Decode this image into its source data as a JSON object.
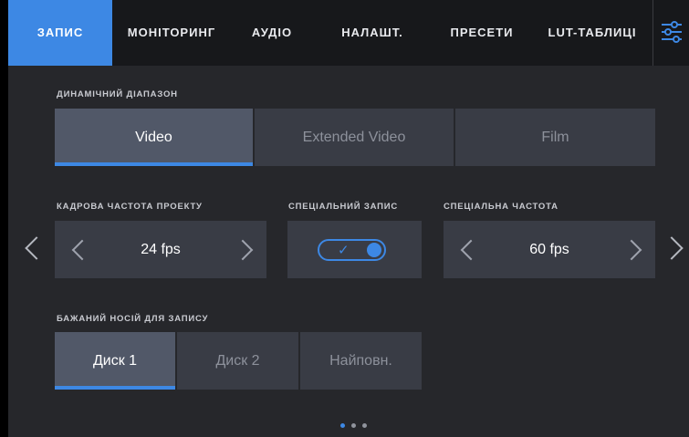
{
  "tabs": [
    {
      "label": "ЗАПИС",
      "active": true
    },
    {
      "label": "МОНІТОРИНГ",
      "active": false
    },
    {
      "label": "АУДІО",
      "active": false
    },
    {
      "label": "НАЛАШТ.",
      "active": false
    },
    {
      "label": "ПРЕСЕТИ",
      "active": false
    },
    {
      "label": "LUT-ТАБЛИЦІ",
      "active": false
    }
  ],
  "menu_icon": "sliders-icon",
  "dynamic_range": {
    "label": "ДИНАМІЧНИЙ ДІАПАЗОН",
    "options": [
      "Video",
      "Extended Video",
      "Film"
    ],
    "selected": "Video"
  },
  "project_frame_rate": {
    "label": "КАДРОВА ЧАСТОТА ПРОЕКТУ",
    "value": "24 fps"
  },
  "special_recording": {
    "label": "СПЕЦІАЛЬНИЙ ЗАПИС",
    "enabled": true,
    "check_glyph": "✓"
  },
  "special_frame_rate": {
    "label": "СПЕЦІАЛЬНА ЧАСТОТА",
    "value": "60 fps"
  },
  "preferred_media": {
    "label": "БАЖАНИЙ НОСІЙ ДЛЯ ЗАПИСУ",
    "options": [
      "Диск 1",
      "Диск 2",
      "Найповн."
    ],
    "selected": "Диск 1"
  },
  "pagination": {
    "pages": 3,
    "current": 1
  },
  "colors": {
    "accent": "#3d88e4",
    "background": "#26272b",
    "card": "#393c45",
    "card_active": "#515868",
    "tabbar": "#17181b"
  }
}
